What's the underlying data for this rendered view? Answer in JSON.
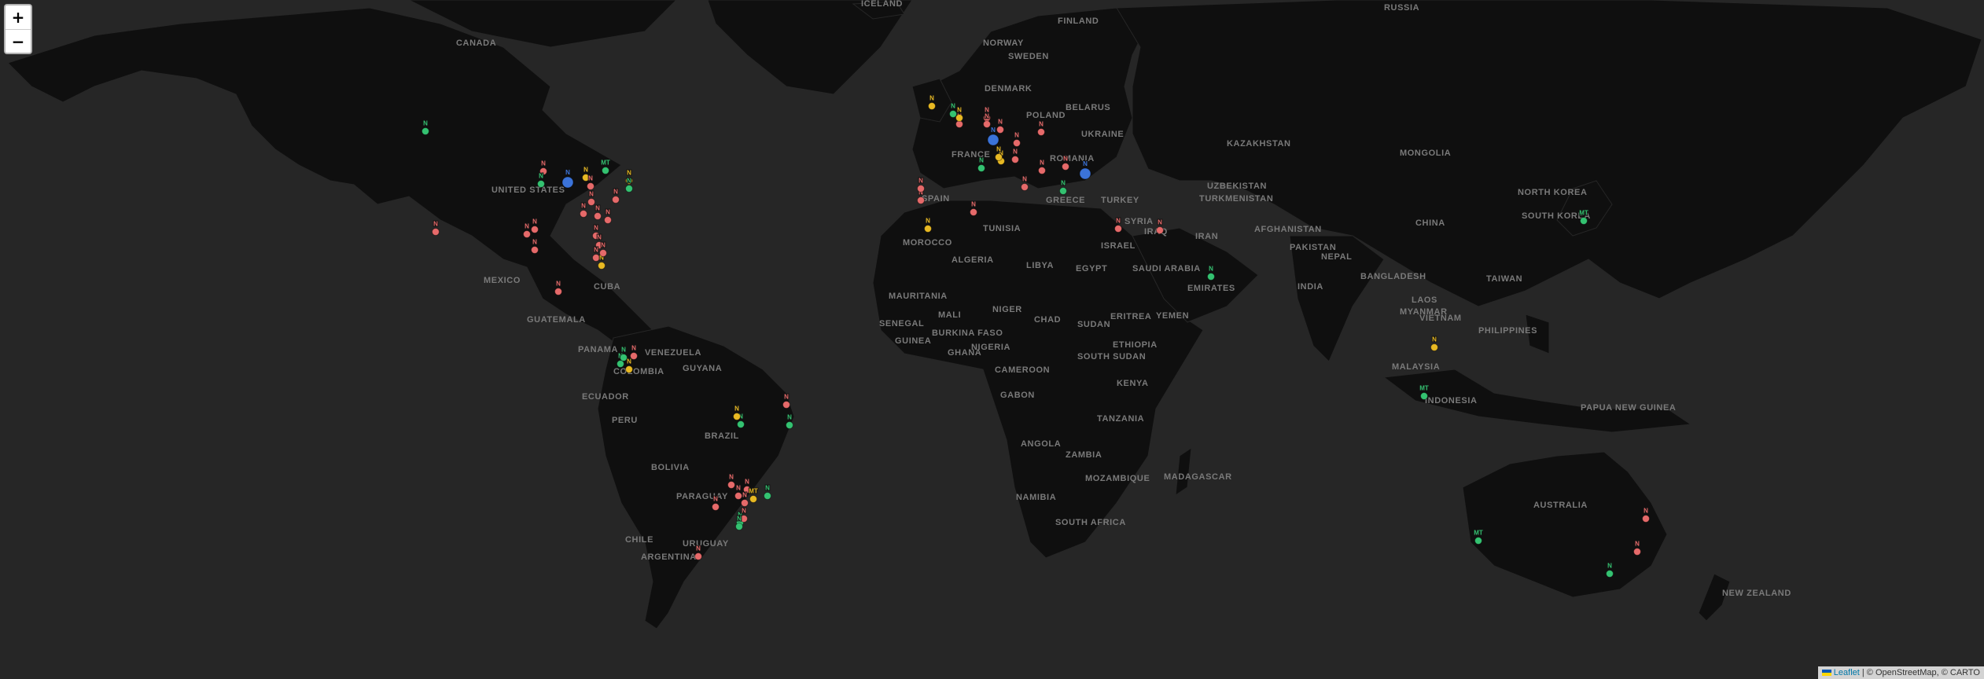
{
  "map": {
    "zoom_in": "+",
    "zoom_out": "−",
    "attribution": {
      "leaflet": "Leaflet",
      "sep": " | © OpenStreetMap, © CARTO"
    },
    "colors": {
      "red": "#e66a6a",
      "green": "#34c271",
      "yellow": "#e8b923",
      "blue": "#3b73d9",
      "land": "#0f0f0f",
      "water": "#262626"
    }
  },
  "countries": [
    "CANADA",
    "RUSSIA",
    "FINLAND",
    "SWEDEN",
    "NORWAY",
    "DENMARK",
    "POLAND",
    "BELARUS",
    "UKRAINE",
    "ROMANIA",
    "GREECE",
    "TURKEY",
    "IRAN",
    "IRAQ",
    "SYRIA",
    "ISRAEL",
    "SAUDI ARABIA",
    "EMIRATES",
    "YEMEN",
    "KAZAKHSTAN",
    "UZBEKISTAN",
    "TURKMENISTAN",
    "AFGHANISTAN",
    "PAKISTAN",
    "INDIA",
    "NEPAL",
    "BANGLADESH",
    "MYANMAR",
    "LAOS",
    "VIETNAM",
    "PHILIPPINES",
    "TAIWAN",
    "CHINA",
    "MONGOLIA",
    "NORTH KOREA",
    "SOUTH KOREA",
    "MALAYSIA",
    "INDONESIA",
    "PAPUA NEW GUINEA",
    "AUSTRALIA",
    "NEW ZEALAND",
    "UNITED STATES",
    "MEXICO",
    "GUATEMALA",
    "CUBA",
    "PANAMA",
    "VENEZUELA",
    "COLOMBIA",
    "ECUADOR",
    "PERU",
    "BRAZIL",
    "BOLIVIA",
    "PARAGUAY",
    "CHILE",
    "ARGENTINA",
    "URUGUAY",
    "GUYANA",
    "SPAIN",
    "FRANCE",
    "MOROCCO",
    "TUNISIA",
    "ALGERIA",
    "LIBYA",
    "EGYPT",
    "MAURITANIA",
    "MALI",
    "NIGER",
    "CHAD",
    "SUDAN",
    "ERITREA",
    "ETHIOPIA",
    "SENEGAL",
    "GUINEA",
    "BURKINA FASO",
    "GHANA",
    "NIGERIA",
    "CAMEROON",
    "GABON",
    "KENYA",
    "TANZANIA",
    "ANGOLA",
    "ZAMBIA",
    "NAMIBIA",
    "MOZAMBIQUE",
    "SOUTH AFRICA",
    "SOUTH SUDAN",
    "ICELAND",
    "MADAGASCAR"
  ],
  "markers": [
    {
      "c": "green",
      "t": "N"
    },
    {
      "c": "red",
      "t": "N"
    },
    {
      "c": "green",
      "t": "N"
    },
    {
      "c": "blue",
      "t": "N"
    },
    {
      "c": "yellow",
      "t": "N"
    },
    {
      "c": "red",
      "t": "N"
    },
    {
      "c": "green",
      "t": "MT"
    },
    {
      "c": "yellow",
      "t": "N"
    },
    {
      "c": "green",
      "t": "N"
    },
    {
      "c": "red",
      "t": "N"
    },
    {
      "c": "red",
      "t": "N"
    },
    {
      "c": "red",
      "t": "N"
    },
    {
      "c": "red",
      "t": "N"
    },
    {
      "c": "red",
      "t": "N"
    },
    {
      "c": "red",
      "t": "N"
    },
    {
      "c": "red",
      "t": "N"
    },
    {
      "c": "red",
      "t": "N"
    },
    {
      "c": "red",
      "t": "N"
    },
    {
      "c": "red",
      "t": "N"
    },
    {
      "c": "red",
      "t": "N"
    },
    {
      "c": "yellow",
      "t": "N"
    },
    {
      "c": "red",
      "t": "N"
    },
    {
      "c": "red",
      "t": "N"
    },
    {
      "c": "red",
      "t": "N"
    },
    {
      "c": "green",
      "t": "N"
    },
    {
      "c": "yellow",
      "t": "N"
    },
    {
      "c": "red",
      "t": "N"
    },
    {
      "c": "green",
      "t": "N"
    },
    {
      "c": "green",
      "t": "N"
    },
    {
      "c": "yellow",
      "t": "N"
    },
    {
      "c": "green",
      "t": "N"
    },
    {
      "c": "red",
      "t": "N"
    },
    {
      "c": "green",
      "t": "N"
    },
    {
      "c": "red",
      "t": "N"
    },
    {
      "c": "red",
      "t": "N"
    },
    {
      "c": "red",
      "t": "N"
    },
    {
      "c": "green",
      "t": "N"
    },
    {
      "c": "red",
      "t": "N"
    },
    {
      "c": "yellow",
      "t": "MT"
    },
    {
      "c": "red",
      "t": "N"
    },
    {
      "c": "red",
      "t": "N"
    },
    {
      "c": "green",
      "t": "N"
    },
    {
      "c": "red",
      "t": "N"
    },
    {
      "c": "yellow",
      "t": "N"
    },
    {
      "c": "green",
      "t": "N"
    },
    {
      "c": "red",
      "t": "N"
    },
    {
      "c": "red",
      "t": "N"
    },
    {
      "c": "red",
      "t": "N"
    },
    {
      "c": "yellow",
      "t": "N"
    },
    {
      "c": "red",
      "t": "N"
    },
    {
      "c": "blue",
      "t": "N"
    },
    {
      "c": "red",
      "t": "N"
    },
    {
      "c": "yellow",
      "t": "N"
    },
    {
      "c": "green",
      "t": "N"
    },
    {
      "c": "yellow",
      "t": "N"
    },
    {
      "c": "red",
      "t": "N"
    },
    {
      "c": "red",
      "t": "N"
    },
    {
      "c": "red",
      "t": "N"
    },
    {
      "c": "red",
      "t": "N"
    },
    {
      "c": "red",
      "t": "N"
    },
    {
      "c": "blue",
      "t": "N"
    },
    {
      "c": "red",
      "t": "N"
    },
    {
      "c": "green",
      "t": "N"
    },
    {
      "c": "yellow",
      "t": "N"
    },
    {
      "c": "red",
      "t": "N"
    },
    {
      "c": "red",
      "t": "N"
    },
    {
      "c": "red",
      "t": "N"
    },
    {
      "c": "green",
      "t": "N"
    },
    {
      "c": "red",
      "t": "N"
    },
    {
      "c": "red",
      "t": "N"
    },
    {
      "c": "yellow",
      "t": "N"
    },
    {
      "c": "green",
      "t": "MT"
    },
    {
      "c": "green",
      "t": "MT"
    },
    {
      "c": "green",
      "t": "MT"
    },
    {
      "c": "red",
      "t": "N"
    },
    {
      "c": "red",
      "t": "N"
    },
    {
      "c": "green",
      "t": "N"
    }
  ]
}
